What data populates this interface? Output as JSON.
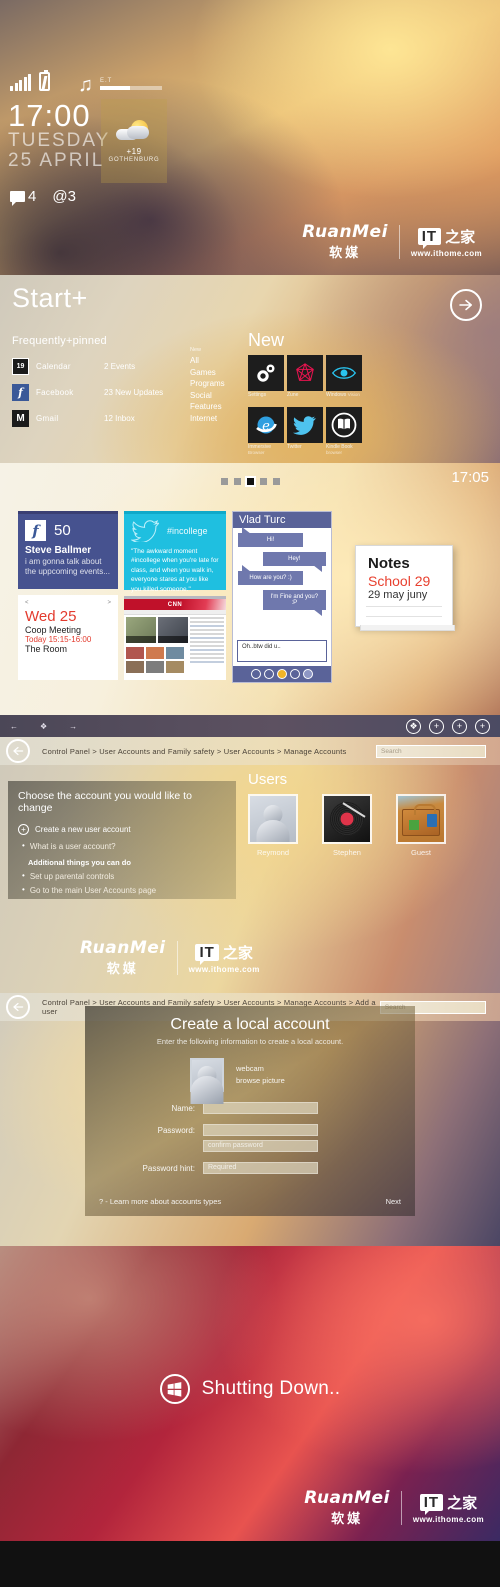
{
  "lockscreen": {
    "time": "17:00",
    "day": "TUESDAY",
    "date": "25 APRIL",
    "music_label": "E.T",
    "weather": {
      "temp": "+19",
      "city": "GOTHENBURG"
    },
    "notifications": [
      {
        "icon": "chat-icon",
        "count": "4"
      },
      {
        "icon": "at-icon",
        "count": "@3"
      }
    ]
  },
  "brand": {
    "name": "RuanMei",
    "name_cn": "软媒",
    "it": "IT",
    "it_cn": "之家",
    "url": "www.ithome.com"
  },
  "startplus": {
    "title": "Start+",
    "next_icon": "arrow-right-icon",
    "frequently_header": "Frequently+pinned",
    "frequent_items": [
      {
        "icon": "calendar-icon",
        "icon_text": "19",
        "name": "Calendar",
        "detail": "2 Events"
      },
      {
        "icon": "facebook-icon",
        "icon_text": "f",
        "name": "Facebook",
        "detail": "23 New Updates"
      },
      {
        "icon": "gmail-icon",
        "icon_text": "M",
        "name": "Gmail",
        "detail": "12 Inbox"
      }
    ],
    "categories_label": "New",
    "categories": [
      "All",
      "Games",
      "Programs",
      "Social",
      "Features",
      "Internet"
    ],
    "new_header": "New",
    "new_tiles": [
      {
        "name": "Settings",
        "sub": "",
        "icon": "gears-icon"
      },
      {
        "name": "Zune",
        "sub": "",
        "icon": "zune-icon"
      },
      {
        "name": "Windows",
        "sub": "Vision",
        "icon": "eye-icon"
      },
      {
        "name": "Immersive",
        "sub": "Browser",
        "icon": "internet-explorer-icon"
      },
      {
        "name": "Twitter",
        "sub": "",
        "icon": "twitter-bird-icon"
      },
      {
        "name": "Kindle Book",
        "sub": "browser",
        "icon": "open-book-icon"
      }
    ]
  },
  "desktop": {
    "time": "17:05",
    "pager": {
      "count": 5,
      "active_index": 2
    },
    "facebook_tile": {
      "badge": "f",
      "count": "50",
      "name": "Steve Ballmer",
      "message": "i am gonna talk about the uppcoming events..."
    },
    "calendar_tile": {
      "prev": "<",
      "next": ">",
      "day": "Wed 25",
      "title": "Coop Meeting",
      "time": "Today 15:15-16:00",
      "room": "The Room"
    },
    "twitter_tile": {
      "hashtag": "#incollege",
      "quote": "\"The awkward moment #incollege when you're late for class, and when you walk in, everyone stares at you like you killed someone.\""
    },
    "news_tile": {
      "logo": "CNN"
    },
    "chat_tile": {
      "contact": "Vlad Turc",
      "messages": [
        {
          "side": "left",
          "text": "Hi!"
        },
        {
          "side": "right",
          "text": "Hey!"
        },
        {
          "side": "left",
          "text": "How are you? :)"
        },
        {
          "side": "right",
          "text": "I'm Fine and you? :P"
        }
      ],
      "input_value": "Oh..btw did u.."
    },
    "notes_tile": {
      "title": "Notes",
      "subject": "School 29",
      "date": "29 may juny"
    }
  },
  "taskbar": {
    "back_icon": "arrow-left-icon",
    "windows_icon": "windows-icon",
    "forward_icon": "arrow-right-icon",
    "buttons": [
      "windows-icon",
      "plus-icon",
      "plus-icon",
      "plus-icon"
    ]
  },
  "manage_accounts": {
    "breadcrumb": "Control Panel > User Accounts and Family safety > User Accounts > Manage Accounts",
    "search_placeholder": "Search",
    "back_icon": "back-arrow-icon",
    "heading": "Choose the account you would like to change",
    "create_link": "Create a new user account",
    "what_is_link": "What is a user account?",
    "additional_header": "Additional things you can do",
    "additional_links": [
      "Set up parental controls",
      "Go to the main User Accounts page"
    ],
    "users_header": "Users",
    "users": [
      {
        "name": "Reymond",
        "avatar": "generic-user-avatar"
      },
      {
        "name": "Stephen",
        "avatar": "record-player-avatar"
      },
      {
        "name": "Guest",
        "avatar": "suitcase-avatar"
      }
    ]
  },
  "create_account": {
    "breadcrumb": "Control Panel > User Accounts and Family safety > User Accounts > Manage Accounts > Add a user",
    "search_placeholder": "Search",
    "back_icon": "back-arrow-icon",
    "title": "Create a local account",
    "subtitle": "Enter the following information to create a local account.",
    "picture_links": [
      "webcam",
      "browse picture"
    ],
    "fields": [
      {
        "label": "Name:",
        "value": "",
        "placeholder": ""
      },
      {
        "label": "Password:",
        "value": "",
        "placeholder": ""
      },
      {
        "label": "",
        "value": "",
        "placeholder": "confirm password"
      },
      {
        "label": "Password hint:",
        "value": "",
        "placeholder": "Required"
      }
    ],
    "help_link": "? - Learn more about accounts types",
    "next_button": "Next"
  },
  "shutdown": {
    "icon": "windows-icon",
    "text": "Shutting Down.."
  }
}
